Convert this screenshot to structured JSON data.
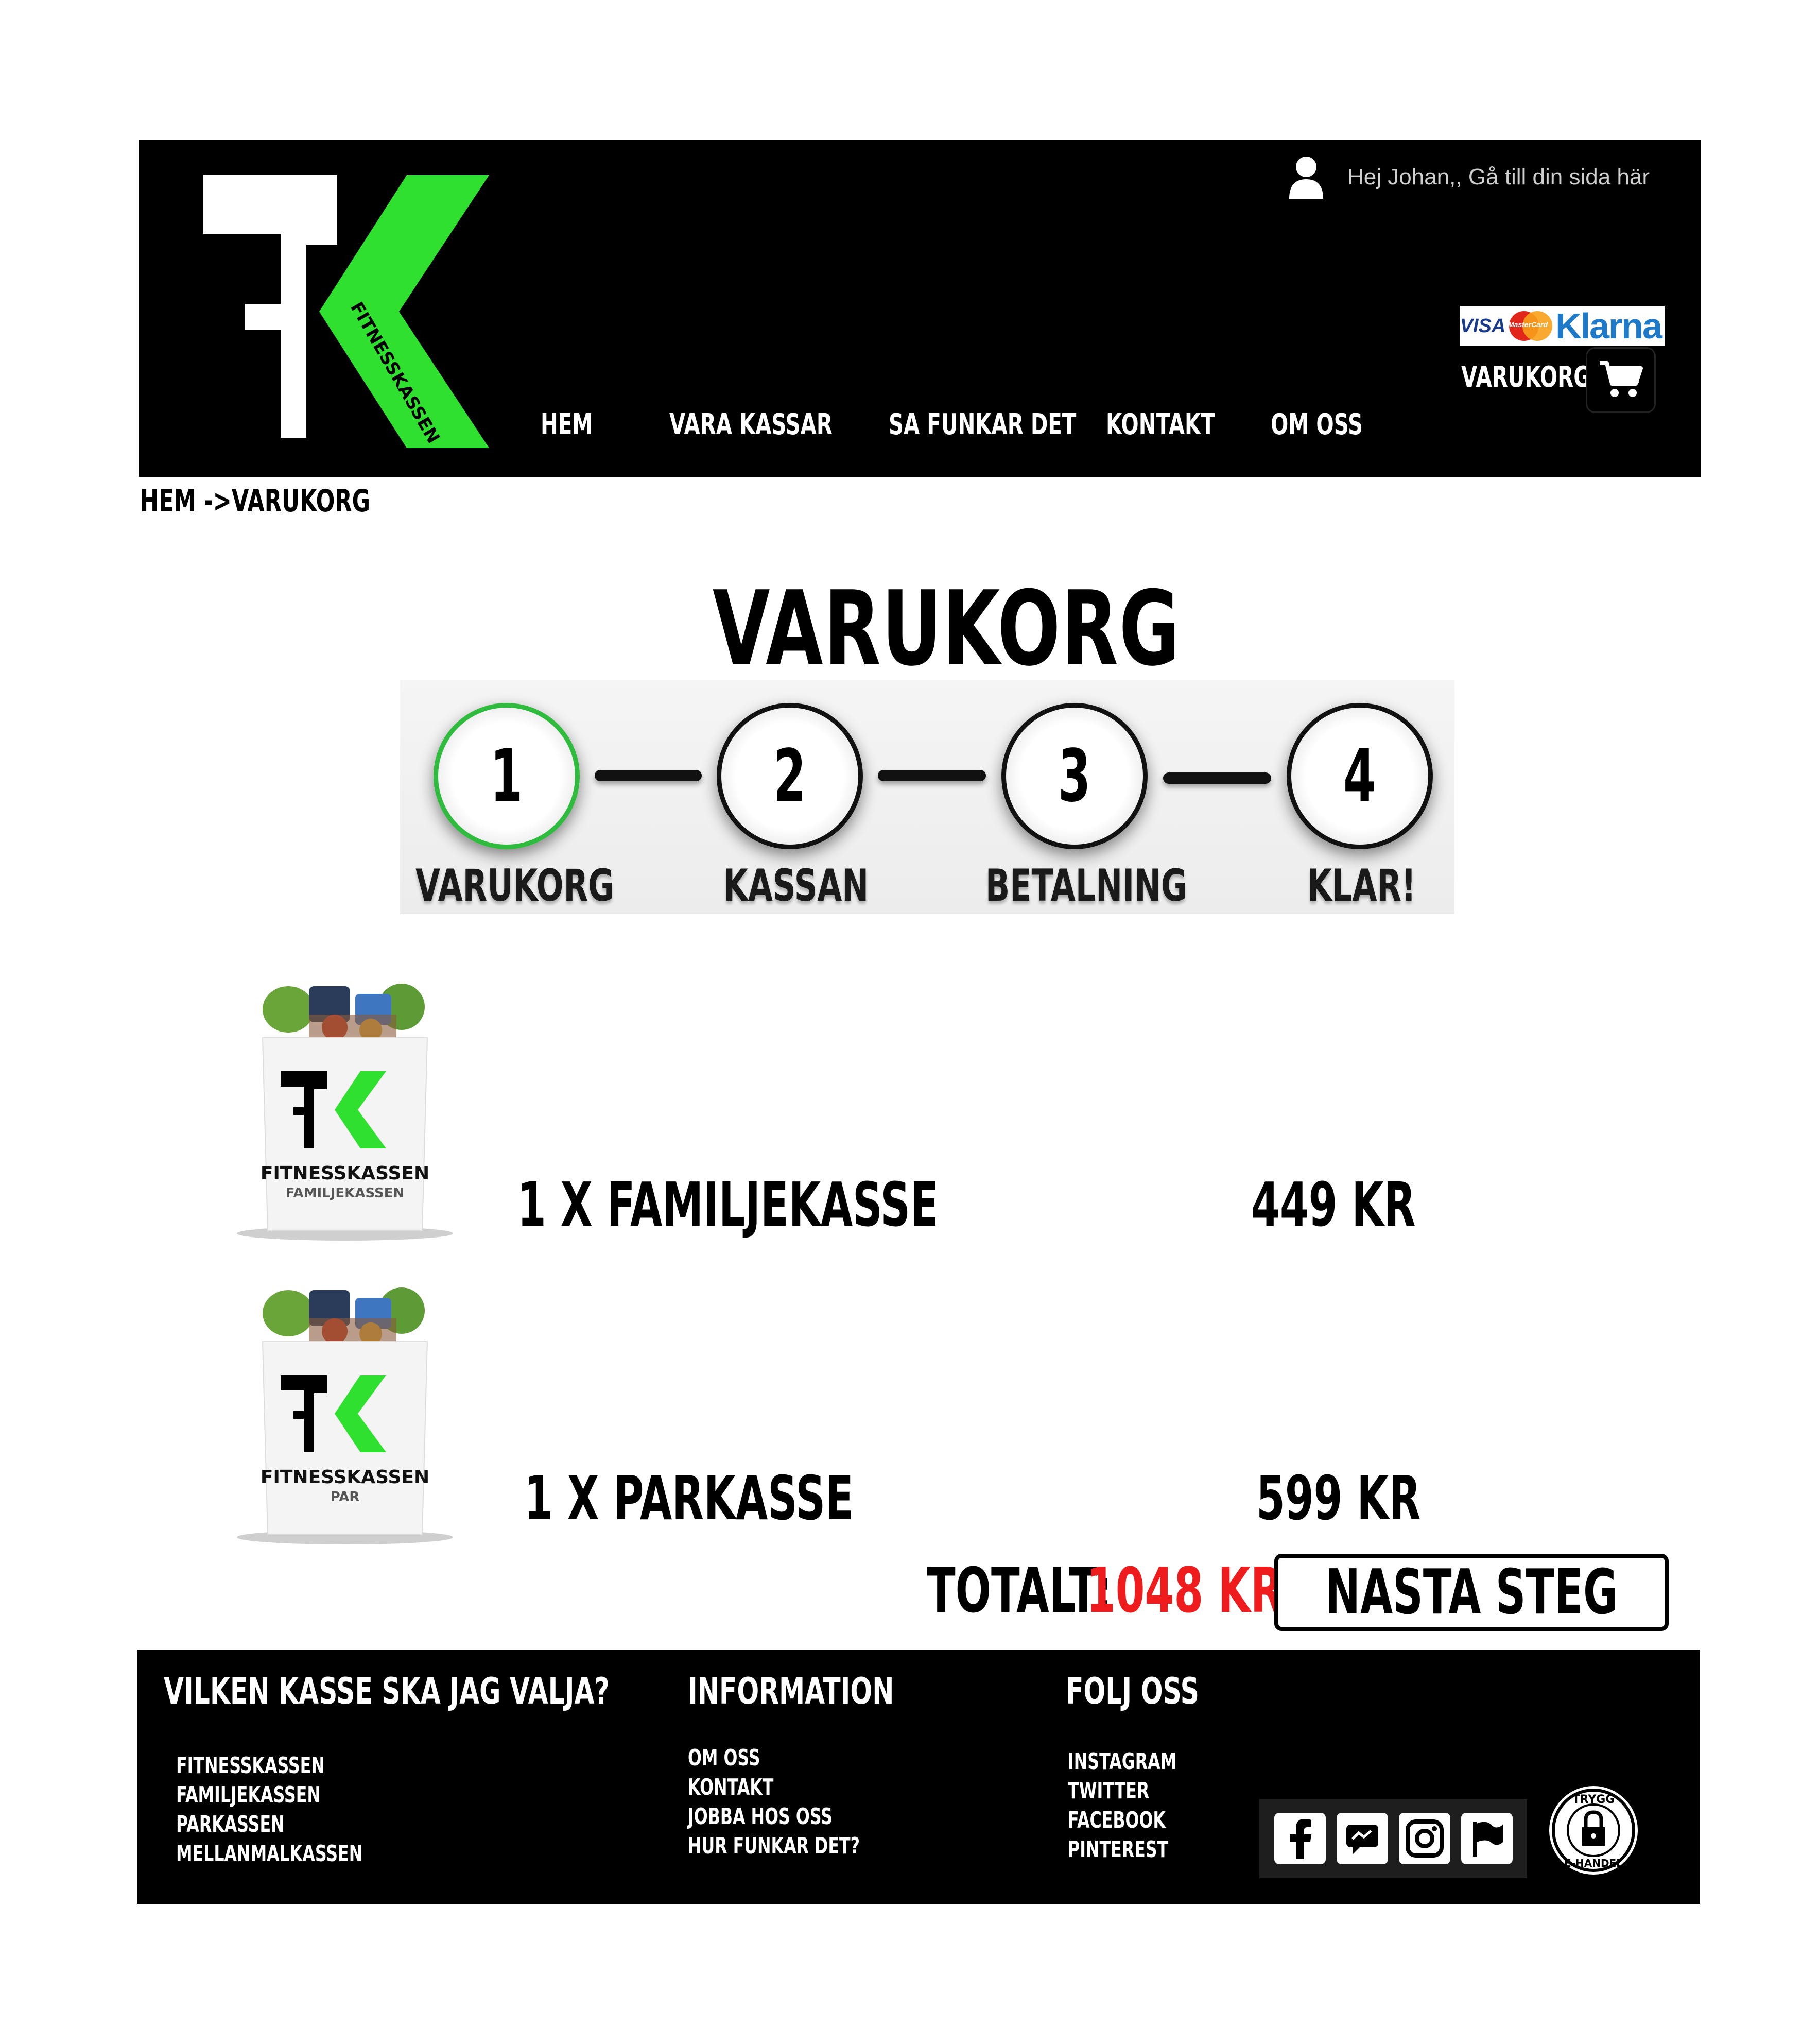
{
  "header": {
    "logo_text": "FITNESSKASSEN",
    "user_greeting": "Hej Johan,, Gå till din sida här",
    "cart_label": "VARUKORG (1)",
    "nav": [
      "HEM",
      "VARA KASSAR",
      "SA FUNKAR DET",
      "KONTAKT",
      "OM OSS"
    ],
    "payments": {
      "visa": "VISA",
      "mastercard": "MasterCard",
      "klarna": "Klarna"
    }
  },
  "breadcrumb": "HEM  ->VARUKORG",
  "title": "VARUKORG",
  "steps": [
    {
      "num": "1",
      "label": "VARUKORG",
      "active": true
    },
    {
      "num": "2",
      "label": "KASSAN",
      "active": false
    },
    {
      "num": "3",
      "label": "BETALNING",
      "active": false
    },
    {
      "num": "4",
      "label": "KLAR!",
      "active": false
    }
  ],
  "items": [
    {
      "name": "1 X FAMILJEKASSE",
      "price": "449 KR",
      "bag_brand": "FITNESSKASSEN",
      "bag_sub": "FAMILJEKASSEN"
    },
    {
      "name": "1 X PARKASSE",
      "price": "599 KR",
      "bag_brand": "FITNESSKASSEN",
      "bag_sub": "PAR"
    }
  ],
  "total": {
    "label": "TOTALT:",
    "value": "1048 KR"
  },
  "next_button": "NASTA STEG",
  "footer": {
    "col1": {
      "heading": "VILKEN KASSE SKA JAG VALJA?",
      "links": [
        "FITNESSKASSEN",
        "FAMILJEKASSEN",
        "PARKASSEN",
        "MELLANMALKASSEN"
      ]
    },
    "col2": {
      "heading": "INFORMATION",
      "links": [
        "OM OSS",
        "KONTAKT",
        "JOBBA HOS OSS",
        "HUR FUNKAR DET?"
      ]
    },
    "col3": {
      "heading": "FOLJ OSS",
      "links": [
        "INSTAGRAM",
        "TWITTER",
        "FACEBOOK",
        "PINTEREST"
      ]
    },
    "badge_text": "TRYGG E-HANDEL",
    "social_icons": [
      "facebook-icon",
      "messenger-icon",
      "instagram-icon",
      "flag-icon"
    ]
  },
  "colors": {
    "brand_green": "#2fe02f",
    "price_red": "#ee1c1c",
    "header_bg": "#000000"
  }
}
